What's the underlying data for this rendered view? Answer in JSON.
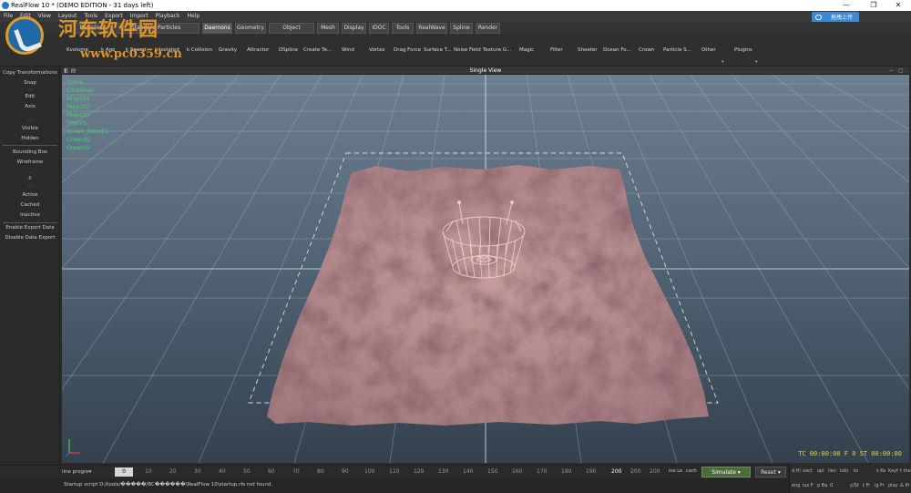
{
  "titlebar": {
    "title": "RealFlow 10 * (DEMO EDITION - 31 days left)",
    "minimize": "—",
    "restore": "❐",
    "close": "✕"
  },
  "menu": [
    "File",
    "Edit",
    "View",
    "Layout",
    "Tools",
    "Export",
    "Import",
    "Playback",
    "Help"
  ],
  "cloud_button": "拖拽上传",
  "tabs": [
    {
      "label": "Particles",
      "active": false
    },
    {
      "label": "Standard Particles",
      "active": false
    },
    {
      "label": "Daemons",
      "active": true
    },
    {
      "label": "Geometry",
      "active": false
    },
    {
      "label": "Object Dynamics",
      "active": false
    },
    {
      "label": "Mesh",
      "active": false
    },
    {
      "label": "Display",
      "active": false
    },
    {
      "label": "IDOC",
      "active": false
    },
    {
      "label": "Tools",
      "active": false
    },
    {
      "label": "RealWave",
      "active": false
    },
    {
      "label": "Spline",
      "active": false
    },
    {
      "label": "Render",
      "active": false
    }
  ],
  "shelf": [
    "Kvolume",
    "k Age",
    "k Speed",
    "k Isolated",
    "k Collision",
    "Gravity",
    "Attractor",
    "DSpline",
    "Create Te...",
    "Wind",
    "Vortex",
    "Drag Force",
    "Surface T...",
    "Noise Field",
    "Texture G...",
    "Magic",
    "Filter",
    "Sheeter",
    "Ocean Fo...",
    "Crown",
    "Particle S...",
    "Other",
    "Plugins"
  ],
  "watermark": {
    "cn": "河东软件园",
    "url": "www.pc0359.cn"
  },
  "left_panel": {
    "items": [
      "Copy Transformations",
      "Snap",
      "Edit",
      "Axis",
      "Visible",
      "Hidden",
      "Bounding Box",
      "Wireframe",
      "Active",
      "Cached",
      "Inactive",
      "Enable Export Data",
      "Disable Data Export"
    ],
    "seps": [
      "....",
      "....",
      "....",
      "8",
      "....",
      "...."
    ]
  },
  "viewport": {
    "title": "Single View",
    "nodes": [
      "Scene",
      "Container",
      "Magic01",
      "Magic02",
      "Magic03",
      "Filter01",
      "Ocean_Force01",
      "Crown01",
      "Crown02"
    ],
    "timecode": "TC 00:00:00  F 0  ST 00:00:00"
  },
  "timeline": {
    "dropdown": "line progre▾",
    "frame": "0",
    "ticks": [
      "10",
      "20",
      "30",
      "40",
      "50",
      "60",
      "70",
      "80",
      "90",
      "100",
      "110",
      "120",
      "130",
      "140",
      "150",
      "160",
      "170",
      "180",
      "190",
      "200"
    ],
    "end_a": "200",
    "end_b": "200",
    "label_a": "ine Le",
    "label_b": "cach",
    "simulate": "Simulate",
    "reset": "Reset"
  },
  "right_panel": {
    "row1": [
      "d Hi",
      "xact",
      "opl",
      "ilev",
      "lobi",
      "to",
      "s Ke",
      "Keyf",
      "t the"
    ],
    "row2": [
      "eng",
      "ius F",
      "p Ba",
      "0",
      "y/St",
      "t Fr",
      "ig Fr",
      "play",
      "& Pr"
    ]
  },
  "status": {
    "message": "Startup script D:/tools/�����/BC������\\RealFlow 10\\startup.rfs not found."
  },
  "colors": {
    "accent": "#3d87d6",
    "node_text": "#3fd86a",
    "timecode": "#e3d23a",
    "terrain": "#b6898c"
  }
}
